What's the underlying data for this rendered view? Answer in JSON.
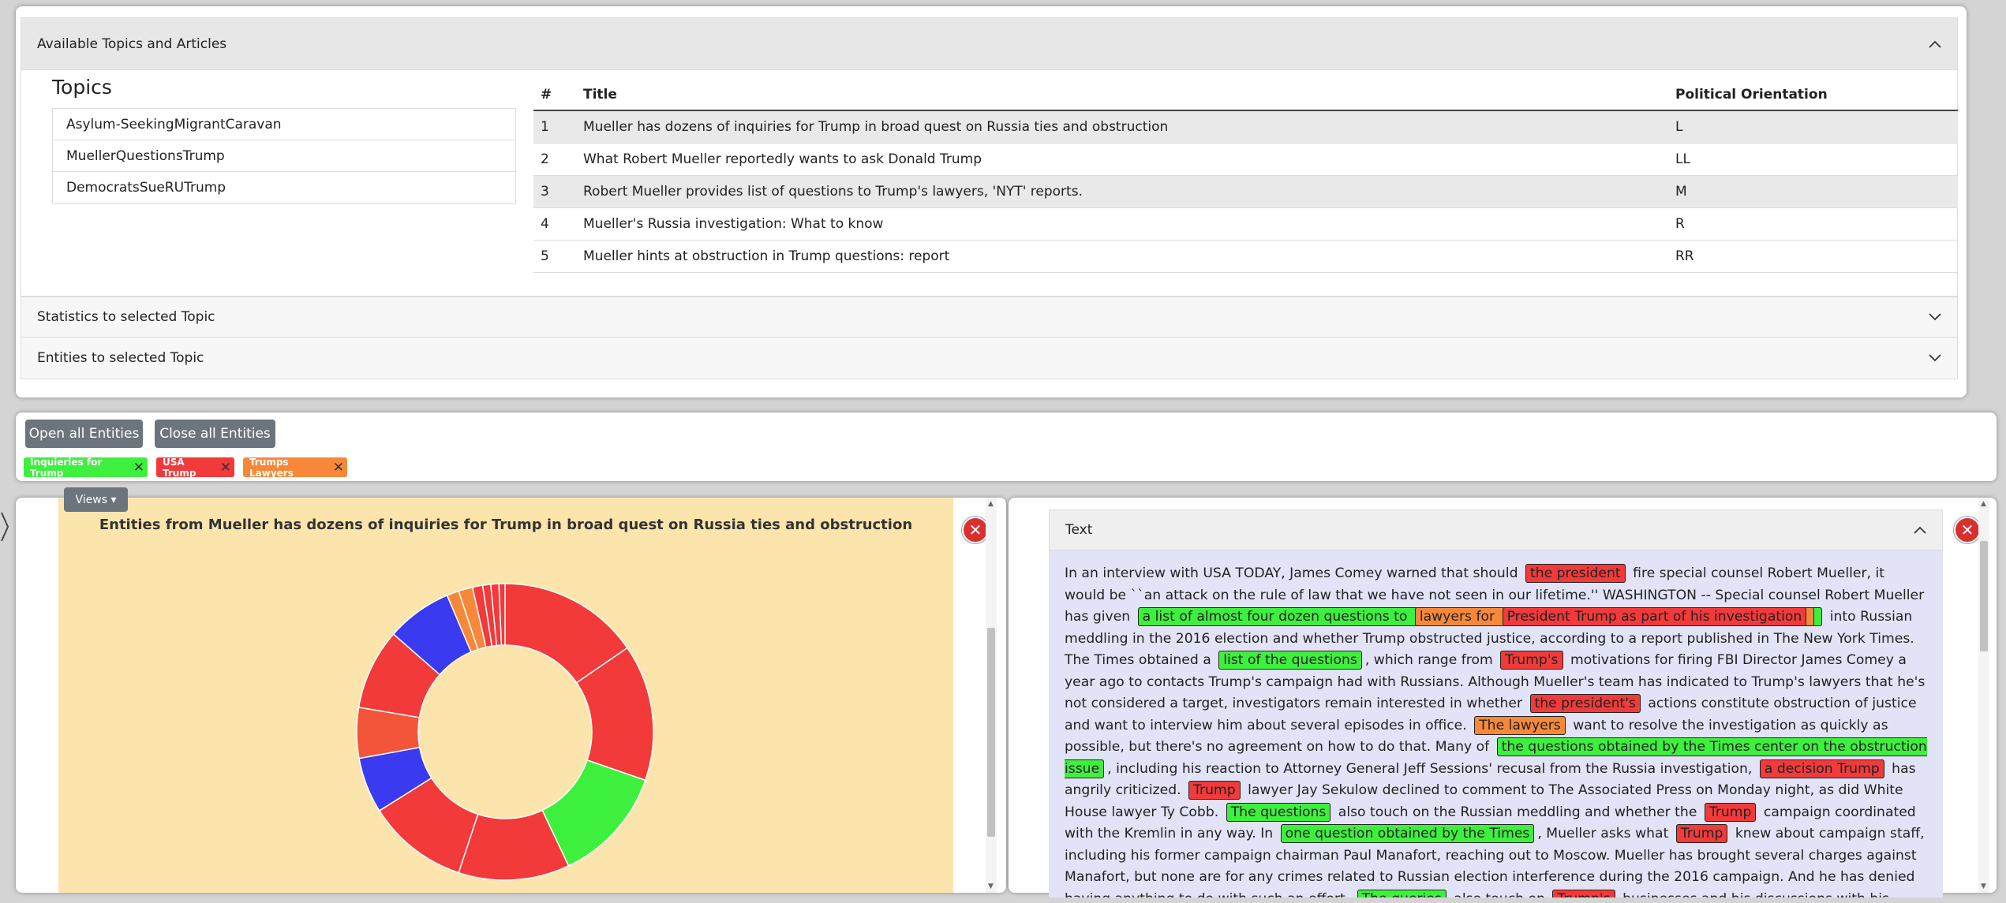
{
  "top": {
    "header": "Available Topics and Articles",
    "topics_title": "Topics",
    "topics": [
      "Asylum-SeekingMigrantCaravan",
      "MuellerQuestionsTrump",
      "DemocratsSueRUTrump"
    ],
    "table_headers": {
      "num": "#",
      "title": "Title",
      "orientation": "Political Orientation"
    },
    "articles": [
      {
        "num": "1",
        "title": "Mueller has dozens of inquiries for Trump in broad quest on Russia ties and obstruction",
        "orientation": "L"
      },
      {
        "num": "2",
        "title": "What Robert Mueller reportedly wants to ask Donald Trump",
        "orientation": "LL"
      },
      {
        "num": "3",
        "title": "Robert Mueller provides list of questions to Trump's lawyers, 'NYT' reports.",
        "orientation": "M"
      },
      {
        "num": "4",
        "title": "Mueller's Russia investigation: What to know",
        "orientation": "R"
      },
      {
        "num": "5",
        "title": "Mueller hints at obstruction in Trump questions: report",
        "orientation": "RR"
      }
    ],
    "stats_header": "Statistics to selected Topic",
    "entities_header": "Entities to selected Topic"
  },
  "entity_bar": {
    "open_all": "Open all Entities",
    "close_all": "Close all Entities",
    "tags": [
      {
        "label": "Inquieries for Trump",
        "color": "#3ef03e"
      },
      {
        "label": "USA Trump",
        "color": "#f23a3a"
      },
      {
        "label": "Trumps Lawyers",
        "color": "#f7883a"
      }
    ],
    "close_glyph": "✕"
  },
  "chart_panel": {
    "views_label": "Views ▾",
    "close_glyph": "✕"
  },
  "chart_data": {
    "type": "pie",
    "title": "Entities from Mueller has dozens of inquiries for Trump in broad quest on Russia ties and obstruction",
    "donut": true,
    "slices": [
      {
        "value": 14.0,
        "color": "#f23a3a"
      },
      {
        "value": 13.5,
        "color": "#f23a3a"
      },
      {
        "value": 11.5,
        "color": "#3ef03e"
      },
      {
        "value": 11.0,
        "color": "#f23a3a"
      },
      {
        "value": 10.0,
        "color": "#f23a3a"
      },
      {
        "value": 5.5,
        "color": "#3a3af0"
      },
      {
        "value": 5.0,
        "color": "#f2553a"
      },
      {
        "value": 8.0,
        "color": "#f23a3a"
      },
      {
        "value": 6.5,
        "color": "#3a3af0"
      },
      {
        "value": 1.2,
        "color": "#f7883a"
      },
      {
        "value": 1.4,
        "color": "#f7883a"
      },
      {
        "value": 1.0,
        "color": "#f23a3a"
      },
      {
        "value": 0.8,
        "color": "#f23a3a"
      },
      {
        "value": 0.8,
        "color": "#f23a3a"
      },
      {
        "value": 0.6,
        "color": "#f23a3a"
      }
    ]
  },
  "text_panel": {
    "header": "Text",
    "close_glyph": "✕",
    "segments": [
      {
        "t": "In an interview with USA TODAY, James Comey warned that should "
      },
      {
        "t": "the president",
        "c": "r"
      },
      {
        "t": " fire special counsel Robert Mueller, it would be ``an attack on the rule of law that we have not seen in our lifetime.'' WASHINGTON -- Special counsel Robert Mueller has given "
      },
      {
        "t": "a list of almost four dozen questions to ",
        "c": "g",
        "kids": [
          {
            "t": "lawyers for ",
            "c": "o",
            "kids": [
              {
                "t": "President Trump as part of his investigation",
                "c": "r"
              }
            ]
          }
        ]
      },
      {
        "t": " into Russian meddling in the 2016 election and whether Trump obstructed justice, according to a report published in The New York Times. The Times obtained a "
      },
      {
        "t": "list of the questions",
        "c": "g"
      },
      {
        "t": ", which range from "
      },
      {
        "t": "Trump's",
        "c": "r"
      },
      {
        "t": " motivations for firing FBI Director James Comey a year ago to contacts Trump's campaign had with Russians. Although Mueller's team has indicated to Trump's lawyers that he's not considered a target, investigators remain interested in whether "
      },
      {
        "t": "the president's",
        "c": "r"
      },
      {
        "t": " actions constitute obstruction of justice and want to interview him about several episodes in office. "
      },
      {
        "t": "The lawyers",
        "c": "o"
      },
      {
        "t": " want to resolve the investigation as quickly as possible, but there's no agreement on how to do that. Many of "
      },
      {
        "t": "the questions obtained by the Times center on the obstruction issue",
        "c": "g"
      },
      {
        "t": ", including his reaction to Attorney General Jeff Sessions' recusal from the Russia investigation, "
      },
      {
        "t": "a decision Trump",
        "c": "r"
      },
      {
        "t": " has angrily criticized. "
      },
      {
        "t": "Trump",
        "c": "r"
      },
      {
        "t": " lawyer Jay Sekulow declined to comment to The Associated Press on Monday night, as did White House lawyer Ty Cobb. "
      },
      {
        "t": "The questions",
        "c": "g"
      },
      {
        "t": " also touch on the Russian meddling and whether the "
      },
      {
        "t": "Trump",
        "c": "r"
      },
      {
        "t": " campaign coordinated with the Kremlin in any way. In "
      },
      {
        "t": "one question obtained by the Times",
        "c": "g"
      },
      {
        "t": ", Mueller asks what "
      },
      {
        "t": "Trump",
        "c": "r"
      },
      {
        "t": " knew about campaign staff, including his former campaign chairman Paul Manafort, reaching out to Moscow. Mueller has brought several charges against Manafort, but none are for any crimes related to Russian election interference during the 2016 campaign. And he has denied having anything to do with such an effort. "
      },
      {
        "t": "The queries",
        "c": "g"
      },
      {
        "t": " also touch on "
      },
      {
        "t": "Trump's",
        "c": "r"
      },
      {
        "t": " businesses and his discussions with his"
      }
    ]
  }
}
